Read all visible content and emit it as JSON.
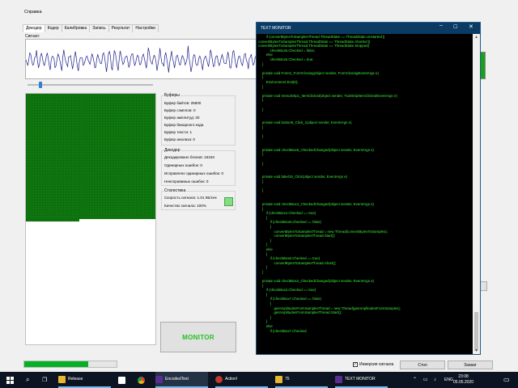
{
  "menu": {
    "help": "Справка"
  },
  "tabs": [
    "Декодер",
    "Кодер",
    "Калибровка",
    "Запись",
    "Результат",
    "Настройки"
  ],
  "signal_label": "Сигнал:",
  "buffers": {
    "title": "Буферы",
    "lines": [
      "Буфер байтов: 25600",
      "Буфер сэмплов: 0",
      "Буфер амплитуд: 30",
      "Буфер бинарного кода",
      "Буфер текста: 1",
      "Буфер анализа: 0"
    ]
  },
  "decoder": {
    "title": "Декодер",
    "lines": [
      "Декодировано блоков: 16193",
      "Одинарных ошибок: 0",
      "Исправлено одинарных ошибок: 0",
      "Неисправимых ошибок: 0"
    ]
  },
  "stats": {
    "title": "Статистика",
    "lines": [
      "Скорость сигнала: 1.01 КБ/сек",
      "Качество сигнала: 100%"
    ]
  },
  "monitor_button": "MONITOR",
  "progress": 0.69,
  "inverse_label": "Инверсия сигнала",
  "inverse_checked": true,
  "stop_button": "Стоп",
  "capture_button": "Захват",
  "monitor_window": {
    "title": "TEXT MONITOR",
    "code": "        if (convertBytesToSamplesThread.ThreadState == ThreadState.Unstarted ||\nconvertBytesToSamplesThread.ThreadState == ThreadState.Aborted ||\nconvertBytesToSamplesThread.ThreadState == ThreadState.Stopped)\n            checkBox6.Checked = false;\n        else\n            checkBox6.Checked = true;\n    }\n\n    private void Form1_FormClosing(object sender, FormClosingEventArgs e)\n    {\n        Environment.Exit(0);\n    }\n\n    private void menuStrip1_ItemClicked(object sender, ToolStripItemClickedEventArgs e)\n    {\n\n    }\n\n\n    private void button9_Click_1(object sender, EventArgs e)\n    {\n\n    }\n\n\n    private void checkBox9_CheckedChanged(object sender, EventArgs e)\n    {\n\n    }\n\n\n    private void label19_Click(object sender, EventArgs e)\n    {\n\n    }\n\n\n    private void checkBox4_CheckedChanged(object sender, EventArgs e)\n    {\n        if (checkBox4.Checked == true)\n        {\n            if (checkBox6.Checked == false)\n            {\n                convertBytesToSamplesThread = new Thread(convertBytesToSamples);\n                convertBytesToSamplesThread.Start();\n            }\n        }\n        else\n        {\n            if (checkBox6.Checked == true)\n                convertBytesToSamplesThread.Abort();\n        }\n    }\n\n    private void checkBox2_CheckedChanged(object sender, EventArgs e)\n    {\n        if (checkBox2.Checked == true)\n        {\n            if (checkBox7.Checked == false)\n            {\n                getAmplitudesFromSamplesThread = new Thread(getAmplitudesFromSamples);\n                getAmplitudesFromSamplesThread.Start();\n            }\n        }\n        else\n            if (checkBox7.Checked"
  },
  "taskbar": {
    "items": [
      "Release",
      "EncodedText",
      "Action!",
      "75",
      "TEXT MONITOR"
    ],
    "lang": "ENG",
    "time": "23:08",
    "date": "05.05.2020"
  },
  "colors": {
    "grid_green": "#118311",
    "code_green": "#3cf03c",
    "titlebar": "#0b3a63",
    "progress_green": "#06b025"
  },
  "icons": [
    "windows-logo-icon",
    "search-icon",
    "task-view-icon",
    "folder-icon",
    "store-icon",
    "chrome-icon",
    "app-icon",
    "minimize-icon",
    "maximize-icon",
    "close-icon"
  ]
}
